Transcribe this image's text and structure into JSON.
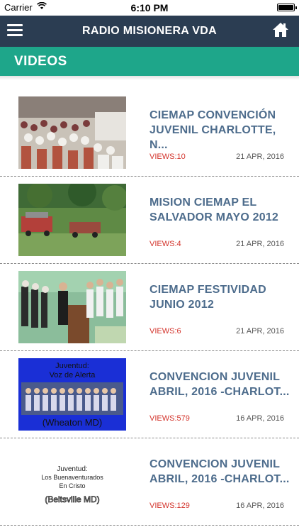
{
  "status_bar": {
    "carrier": "Carrier",
    "time": "6:10 PM"
  },
  "nav": {
    "title": "RADIO MISIONERA VDA"
  },
  "section": {
    "title": "VIDEOS"
  },
  "videos": [
    {
      "title": "CIEMAP CONVENCIÓN JUVENIL CHARLOTTE, N...",
      "views": "VIEWS:10",
      "date": "21 APR, 2016"
    },
    {
      "title": "MISION CIEMAP EL SALVADOR MAYO 2012",
      "views": "VIEWS:4",
      "date": "21 APR, 2016"
    },
    {
      "title": "CIEMAP FESTIVIDAD JUNIO 2012",
      "views": "VIEWS:6",
      "date": "21 APR, 2016"
    },
    {
      "title": "CONVENCION JUVENIL ABRIL, 2016 -CHARLOT...",
      "views": "VIEWS:579",
      "date": "16 APR, 2016",
      "thumb_text": [
        "Juventud:",
        "Voz de Alerta",
        "(Wheaton MD)"
      ]
    },
    {
      "title": "CONVENCION JUVENIL ABRIL, 2016 -CHARLOT...",
      "views": "VIEWS:129",
      "date": "16 APR, 2016",
      "thumb_text": [
        "Juventud:",
        "Los Buenaventurados",
        "En Cristo",
        "(Beltsville MD)"
      ]
    }
  ],
  "colors": {
    "nav_bg": "#2b3d52",
    "section_bg": "#1ea68a",
    "title_text": "#4d6c8c",
    "views_text": "#d3332b"
  }
}
